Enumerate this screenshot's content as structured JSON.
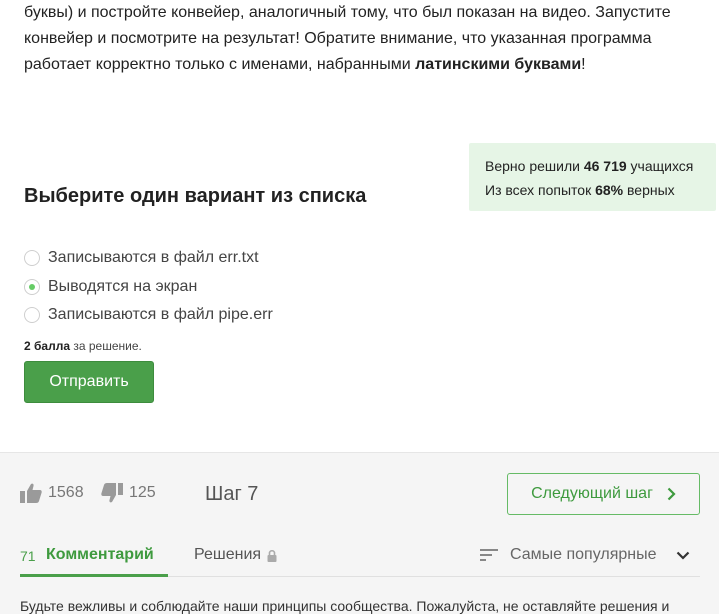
{
  "intro": {
    "line1": "буквы) и постройте конвейер, аналогичный тому, что был показан на видео. Запустите",
    "line2": "конвейер и посмотрите на результат! Обратите внимание, что указанная программа",
    "line3_prefix": "работает корректно только с именами, набранными ",
    "line3_bold": "латинскими буквами",
    "line3_suffix": "!"
  },
  "stats": {
    "solved_prefix": "Верно решили ",
    "solved_count": "46 719",
    "solved_suffix": " учащихся",
    "attempts_prefix": "Из всех попыток ",
    "attempts_percent": "68%",
    "attempts_suffix": " верных"
  },
  "question": {
    "title": "Выберите один вариант из списка",
    "options": [
      {
        "label": "Записываются в файл err.txt",
        "checked": false
      },
      {
        "label": "Выводятся на экран",
        "checked": true
      },
      {
        "label": "Записываются в файл pipe.err",
        "checked": false
      }
    ],
    "score_bold": "2 балла",
    "score_suffix": " за решение.",
    "submit_label": "Отправить"
  },
  "footer": {
    "likes": "1568",
    "dislikes": "125",
    "step": "Шаг 7",
    "next_label": "Следующий шаг",
    "comments_count": "71",
    "tab_comments": "Комментарий",
    "tab_solutions": "Решения",
    "sort_label": "Самые популярные",
    "notice": "Будьте вежливы и соблюдайте наши принципы сообщества. Пожалуйста, не оставляйте решения и"
  },
  "colors": {
    "accent": "#4a9f4a",
    "stats_bg": "#e6f5e6",
    "footer_bg": "#f5f5f5"
  }
}
